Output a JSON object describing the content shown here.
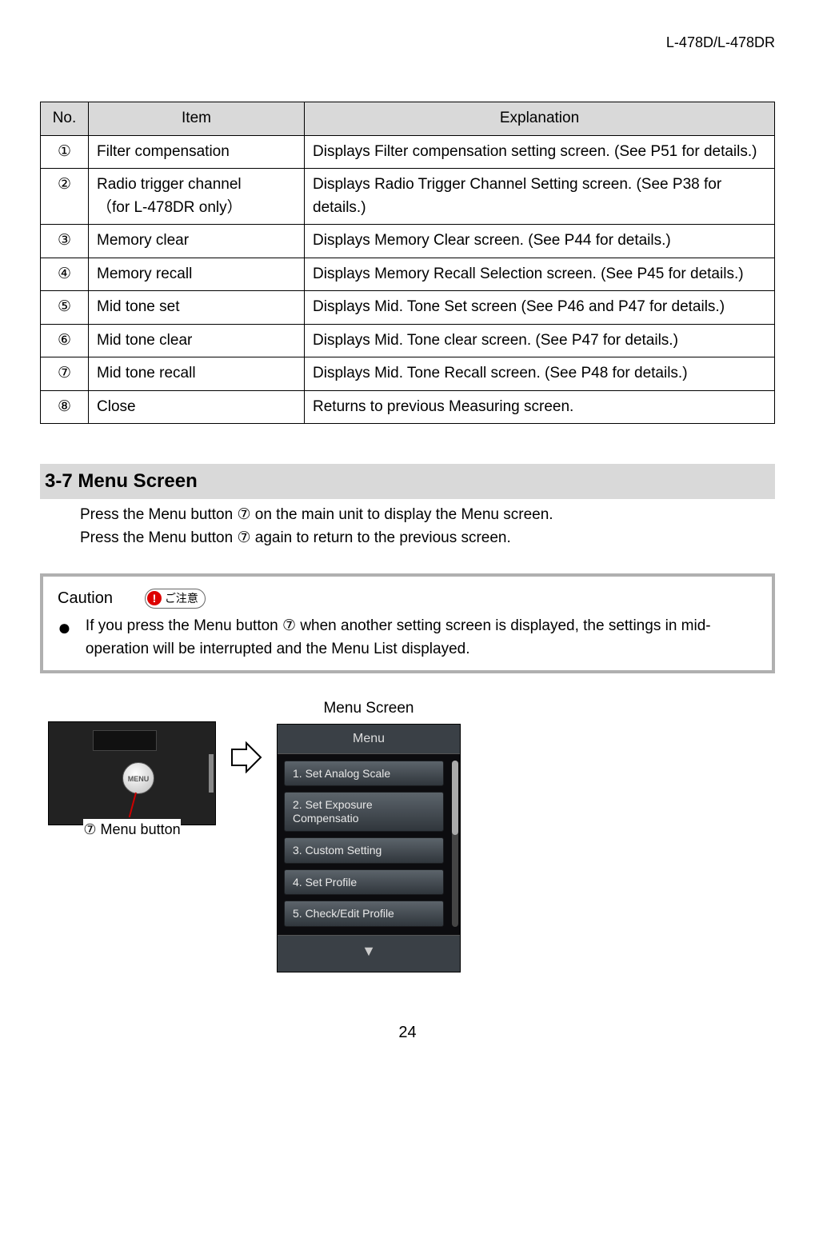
{
  "header": {
    "model": "L-478D/L-478DR"
  },
  "table": {
    "headers": {
      "no": "No.",
      "item": "Item",
      "explanation": "Explanation"
    },
    "rows": [
      {
        "no": "①",
        "item": "Filter compensation",
        "explanation": "Displays Filter compensation setting screen. (See P51 for details.)"
      },
      {
        "no": "②",
        "item": "Radio trigger channel\n（for L-478DR only）",
        "explanation": "Displays Radio Trigger Channel Setting screen. (See P38 for details.)"
      },
      {
        "no": "③",
        "item": "Memory clear",
        "explanation": "Displays Memory Clear screen. (See P44 for details.)"
      },
      {
        "no": "④",
        "item": "Memory recall",
        "explanation": "Displays Memory Recall Selection screen. (See P45 for details.)"
      },
      {
        "no": "⑤",
        "item": "Mid tone set",
        "explanation": "Displays Mid. Tone Set screen (See P46 and P47 for details.)"
      },
      {
        "no": "⑥",
        "item": "Mid tone clear",
        "explanation": "Displays Mid. Tone clear screen. (See P47 for details.)"
      },
      {
        "no": "⑦",
        "item": "Mid tone recall",
        "explanation": "Displays Mid. Tone Recall screen. (See P48 for details.)"
      },
      {
        "no": "⑧",
        "item": "Close",
        "explanation": "Returns to previous Measuring screen."
      }
    ]
  },
  "section": {
    "title": "3-7 Menu Screen",
    "body": [
      "Press the Menu button ⑦ on the main unit to display the Menu screen.",
      "Press the Menu button ⑦ again to return to the previous screen."
    ]
  },
  "caution": {
    "label": "Caution",
    "badge": "ご注意",
    "text": "If you press the Menu button ⑦ when another setting screen is displayed, the settings in mid-operation will be interrupted and the Menu List displayed."
  },
  "diagram": {
    "device_caption": "⑦ Menu button",
    "device_btn_label": "MENU",
    "menu_label": "Menu Screen",
    "menu_title": "Menu",
    "items": [
      "1. Set Analog Scale",
      "2. Set Exposure\n             Compensatio",
      "3. Custom Setting",
      "4. Set Profile",
      "5. Check/Edit Profile"
    ]
  },
  "page_number": "24"
}
